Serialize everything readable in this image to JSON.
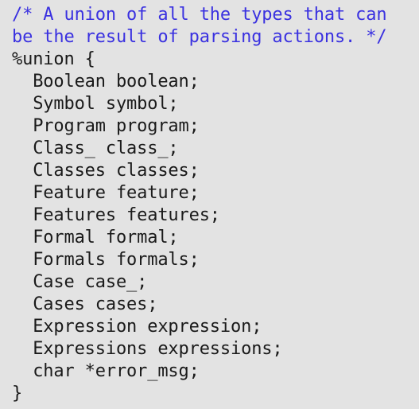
{
  "document": {
    "kind": "source-code-listing",
    "language": "bison-yacc-c",
    "background_color": "#e3e3e3",
    "comment_color": "#3a31e0",
    "code_color": "#1a1a1a"
  },
  "code": {
    "lines": [
      {
        "text": "/* A union of all the types that can",
        "kind": "comment"
      },
      {
        "text": "be the result of parsing actions. */",
        "kind": "comment"
      },
      {
        "text": "%union {",
        "kind": "code"
      },
      {
        "text": "  Boolean boolean;",
        "kind": "code"
      },
      {
        "text": "  Symbol symbol;",
        "kind": "code"
      },
      {
        "text": "  Program program;",
        "kind": "code"
      },
      {
        "text": "  Class_ class_;",
        "kind": "code"
      },
      {
        "text": "  Classes classes;",
        "kind": "code"
      },
      {
        "text": "  Feature feature;",
        "kind": "code"
      },
      {
        "text": "  Features features;",
        "kind": "code"
      },
      {
        "text": "  Formal formal;",
        "kind": "code"
      },
      {
        "text": "  Formals formals;",
        "kind": "code"
      },
      {
        "text": "  Case case_;",
        "kind": "code"
      },
      {
        "text": "  Cases cases;",
        "kind": "code"
      },
      {
        "text": "  Expression expression;",
        "kind": "code"
      },
      {
        "text": "  Expressions expressions;",
        "kind": "code"
      },
      {
        "text": "  char *error_msg;",
        "kind": "code"
      },
      {
        "text": "}",
        "kind": "code"
      }
    ]
  }
}
